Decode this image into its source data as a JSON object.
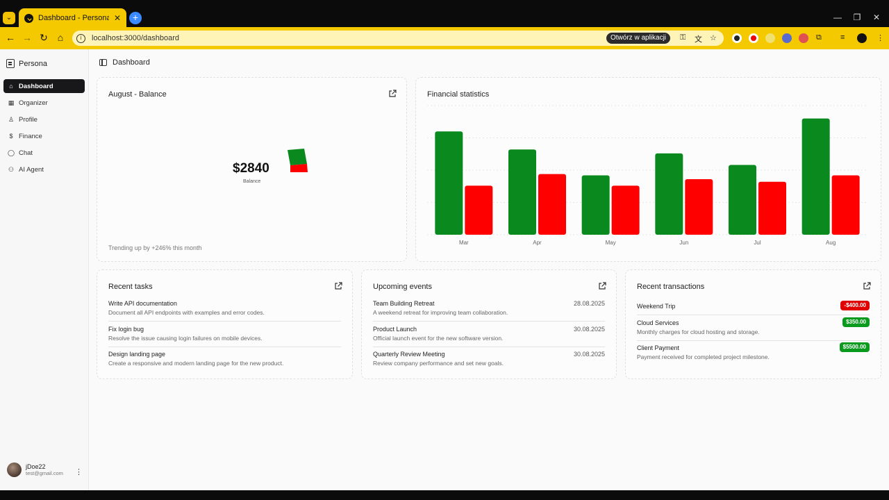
{
  "browser": {
    "tab_title": "Dashboard - Persona",
    "url": "localhost:3000/dashboard",
    "open_in_app": "Otwórz w aplikacji"
  },
  "sidebar": {
    "brand": "Persona",
    "items": [
      {
        "label": "Dashboard",
        "icon": "home-icon",
        "active": true
      },
      {
        "label": "Organizer",
        "icon": "calendar-icon",
        "active": false
      },
      {
        "label": "Profile",
        "icon": "user-icon",
        "active": false
      },
      {
        "label": "Finance",
        "icon": "dollar-icon",
        "active": false
      },
      {
        "label": "Chat",
        "icon": "chat-icon",
        "active": false
      },
      {
        "label": "AI Agent",
        "icon": "bot-icon",
        "active": false
      }
    ],
    "user": {
      "name": "jDoe22",
      "email": "test@gmail.com"
    }
  },
  "header": {
    "breadcrumb": "Dashboard"
  },
  "balance_card": {
    "title": "August - Balance",
    "value": "$2840",
    "label": "Balance",
    "trend": "Trending up by +246% this month"
  },
  "finance_card": {
    "title": "Financial statistics"
  },
  "chart_data": {
    "type": "bar",
    "categories": [
      "Mar",
      "Apr",
      "May",
      "Jun",
      "Jul",
      "Aug"
    ],
    "series": [
      {
        "values": [
          80,
          66,
          46,
          63,
          54,
          90
        ],
        "color": "#0a8a1e"
      },
      {
        "values": [
          38,
          47,
          38,
          43,
          41,
          46
        ],
        "color": "#ff0000"
      }
    ],
    "ylim": [
      0,
      100
    ],
    "grid": true
  },
  "tasks_card": {
    "title": "Recent tasks",
    "items": [
      {
        "title": "Write API documentation",
        "desc": "Document all API endpoints with examples and error codes."
      },
      {
        "title": "Fix login bug",
        "desc": "Resolve the issue causing login failures on mobile devices."
      },
      {
        "title": "Design landing page",
        "desc": "Create a responsive and modern landing page for the new product."
      }
    ]
  },
  "events_card": {
    "title": "Upcoming events",
    "items": [
      {
        "title": "Team Building Retreat",
        "desc": "A weekend retreat for improving team collaboration.",
        "date": "28.08.2025"
      },
      {
        "title": "Product Launch",
        "desc": "Official launch event for the new software version.",
        "date": "30.08.2025"
      },
      {
        "title": "Quarterly Review Meeting",
        "desc": "Review company performance and set new goals.",
        "date": "30.08.2025"
      }
    ]
  },
  "transactions_card": {
    "title": "Recent transactions",
    "items": [
      {
        "title": "Weekend Trip",
        "desc": "",
        "amount": "-$400.00",
        "color": "#e00000"
      },
      {
        "title": "Cloud Services",
        "desc": "Monthly charges for cloud hosting and storage.",
        "amount": "$350.00",
        "color": "#0a9a1e"
      },
      {
        "title": "Client Payment",
        "desc": "Payment received for completed project milestone.",
        "amount": "$5500.00",
        "color": "#0a9a1e"
      }
    ]
  }
}
